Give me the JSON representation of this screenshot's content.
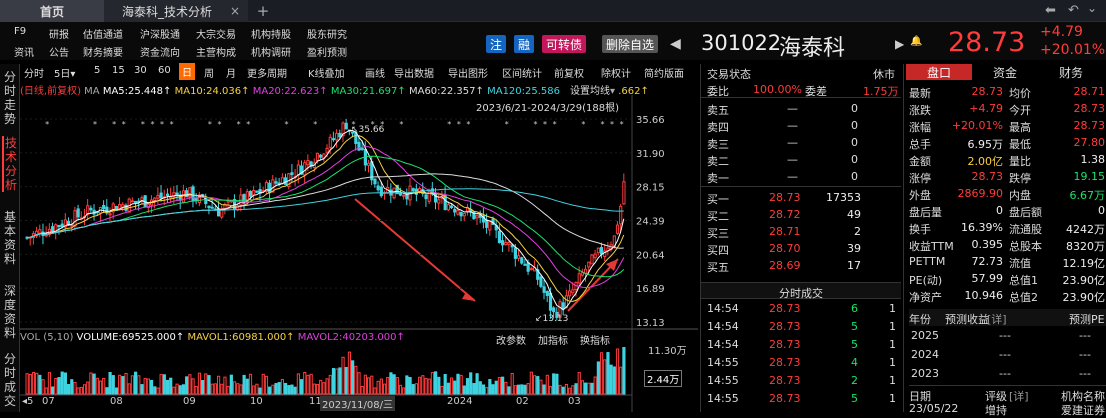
{
  "tabs": {
    "home": "首页",
    "active": "海泰科_技术分析",
    "close": "×",
    "add": "+"
  },
  "window_controls": {
    "back": "⬅",
    "undo": "↶",
    "more": "⌄"
  },
  "menu_row1": [
    "F9",
    "研报",
    "估值通道",
    "沪深股通",
    "大宗交易",
    "机构持股",
    "股东研究"
  ],
  "menu_row2": [
    "资讯",
    "公告",
    "财务摘要",
    "资金流向",
    "主营构成",
    "机构调研",
    "盈利预测"
  ],
  "badges": {
    "zhu": "注",
    "rong": "融",
    "convert": "可转债",
    "delete_fav": "删除自选"
  },
  "stock": {
    "code": "301022",
    "name": "海泰科",
    "price": "28.73",
    "change": "+4.79",
    "change_pct": "+20.01%",
    "prev_arrow": "◀",
    "next_arrow": "▶",
    "bell": "🔔"
  },
  "toolbar": {
    "items": [
      "分时",
      "5日",
      "5",
      "15",
      "30",
      "60",
      "日",
      "周",
      "月",
      "更多周期",
      "K线叠加",
      "画线",
      "导出数据",
      "导出图形",
      "区间统计",
      "前复权",
      "除权计",
      "简约版面"
    ],
    "dropdown_suffix": "▾"
  },
  "left_nav": [
    {
      "label": "分时走势",
      "active": false
    },
    {
      "label": "技术分析",
      "active": true
    },
    {
      "label": "基本资料",
      "active": false
    },
    {
      "label": "深度资料",
      "active": false
    },
    {
      "label": "分时成交",
      "active": false
    }
  ],
  "chart": {
    "legend_prefix": "(日线,前复权)",
    "ma_legend": [
      {
        "label": "MA",
        "color": "#aaaaaa"
      },
      {
        "label": "MA5:25.448↑",
        "color": "#ffffff"
      },
      {
        "label": "MA10:24.036↑",
        "color": "#f5d142"
      },
      {
        "label": "MA20:22.623↑",
        "color": "#e040e0"
      },
      {
        "label": "MA30:21.697↑",
        "color": "#19e36b"
      },
      {
        "label": "MA60:22.357↑",
        "color": "#dddddd"
      },
      {
        "label": "MA120:25.586",
        "color": "#3fd3e0"
      }
    ],
    "ma_tail": ".662↑",
    "setting_label": "设置均线",
    "date_range": "2023/6/21-2024/3/29(188根)",
    "price_ticks": [
      "35.66",
      "31.90",
      "28.15",
      "24.39",
      "20.64",
      "16.89",
      "13.13"
    ],
    "annot_high": "35.66",
    "annot_low": "13.13",
    "vol_legend": [
      {
        "label": "VOL (5,10)",
        "color": "#aaaaaa"
      },
      {
        "label": "VOLUME:69525.000↑",
        "color": "#ffffff"
      },
      {
        "label": "MAVOL1:60981.000↑",
        "color": "#f5d142"
      },
      {
        "label": "MAVOL2:40203.000↑",
        "color": "#e040e0"
      }
    ],
    "vol_tools": [
      "改参数",
      "加指标",
      "换指标"
    ],
    "vol_ticks": [
      "11.30万",
      "2.44万"
    ],
    "x_ticks": [
      "07",
      "08",
      "09",
      "10",
      "11",
      "2023/11/08/三",
      "2024",
      "02",
      "03"
    ],
    "x_left_marker": "◂5"
  },
  "chart_data": {
    "type": "candlestick",
    "title": "",
    "date_range": "2023/6/21-2024/3/29",
    "bars": 188,
    "ylim": [
      13.13,
      35.66
    ],
    "high": 35.66,
    "low": 13.13,
    "last_close": 28.73,
    "ma": {
      "MA5": 25.448,
      "MA10": 24.036,
      "MA20": 22.623,
      "MA30": 21.697,
      "MA60": 22.357,
      "MA120": 25.586
    },
    "volume": {
      "VOLUME": 69525,
      "MAVOL1": 60981,
      "MAVOL2": 40203
    },
    "volume_ticks": [
      "11.30万",
      "2.44万"
    ]
  },
  "orderbook": {
    "title": "交易状态",
    "status": "休市",
    "weibi_label": "委比",
    "weibi": "100.00%",
    "weicha_label": "委差",
    "weicha": "1.75万",
    "sells": [
      {
        "label": "卖五",
        "price": "—",
        "vol": "0"
      },
      {
        "label": "卖四",
        "price": "—",
        "vol": "0"
      },
      {
        "label": "卖三",
        "price": "—",
        "vol": "0"
      },
      {
        "label": "卖二",
        "price": "—",
        "vol": "0"
      },
      {
        "label": "卖一",
        "price": "—",
        "vol": "0"
      }
    ],
    "buys": [
      {
        "label": "买一",
        "price": "28.73",
        "vol": "17353"
      },
      {
        "label": "买二",
        "price": "28.72",
        "vol": "49"
      },
      {
        "label": "买三",
        "price": "28.71",
        "vol": "2"
      },
      {
        "label": "买四",
        "price": "28.70",
        "vol": "39"
      },
      {
        "label": "买五",
        "price": "28.69",
        "vol": "17"
      }
    ],
    "trades_title": "分时成交",
    "trades": [
      {
        "time": "14:54",
        "price": "28.73",
        "vol": "6",
        "n": "1"
      },
      {
        "time": "14:54",
        "price": "28.73",
        "vol": "5",
        "n": "1"
      },
      {
        "time": "14:54",
        "price": "28.73",
        "vol": "5",
        "n": "1"
      },
      {
        "time": "14:55",
        "price": "28.73",
        "vol": "4",
        "n": "1"
      },
      {
        "time": "14:55",
        "price": "28.73",
        "vol": "2",
        "n": "1"
      },
      {
        "time": "14:55",
        "price": "28.73",
        "vol": "5",
        "n": "1"
      }
    ]
  },
  "quote": {
    "tabs": [
      "盘口",
      "资金",
      "财务"
    ],
    "rows": [
      {
        "l1": "最新",
        "v1": "28.73",
        "c1": "red",
        "l2": "均价",
        "v2": "28.71",
        "c2": "red"
      },
      {
        "l1": "涨跌",
        "v1": "+4.79",
        "c1": "red",
        "l2": "今开",
        "v2": "28.73",
        "c2": "red"
      },
      {
        "l1": "涨幅",
        "v1": "+20.01%",
        "c1": "red",
        "l2": "最高",
        "v2": "28.73",
        "c2": "red"
      },
      {
        "l1": "总手",
        "v1": "6.95万",
        "c1": "white",
        "l2": "最低",
        "v2": "27.80",
        "c2": "red"
      },
      {
        "l1": "金额",
        "v1": "2.00亿",
        "c1": "yellow",
        "l2": "量比",
        "v2": "1.38",
        "c2": "white"
      },
      {
        "l1": "涨停",
        "v1": "28.73",
        "c1": "red",
        "l2": "跌停",
        "v2": "19.15",
        "c2": "green"
      },
      {
        "l1": "外盘",
        "v1": "2869.90",
        "c1": "red",
        "l2": "内盘",
        "v2": "6.67万",
        "c2": "green"
      },
      {
        "l1": "盘后量",
        "v1": "0",
        "c1": "white",
        "l2": "盘后额",
        "v2": "0",
        "c2": "white"
      },
      {
        "l1": "换手",
        "v1": "16.39%",
        "c1": "white",
        "l2": "流通股",
        "v2": "4242万",
        "c2": "white"
      },
      {
        "l1": "收益TTM",
        "v1": "0.395",
        "c1": "white",
        "l2": "总股本",
        "v2": "8320万",
        "c2": "white"
      },
      {
        "l1": "PETTM",
        "v1": "72.73",
        "c1": "white",
        "l2": "流值",
        "v2": "12.19亿",
        "c2": "white"
      },
      {
        "l1": "PE(动)",
        "v1": "57.99",
        "c1": "white",
        "l2": "总值1",
        "v2": "23.90亿",
        "c2": "white"
      },
      {
        "l1": "净资产",
        "v1": "10.946",
        "c1": "white",
        "l2": "总值2",
        "v2": "23.90亿",
        "c2": "white"
      }
    ],
    "forecast_head": {
      "year": "年份",
      "eps": "预测收益",
      "detail": "[详]",
      "pe": "预测PE"
    },
    "forecast": [
      {
        "year": "2025",
        "eps": "---",
        "pe": "---"
      },
      {
        "year": "2024",
        "eps": "---",
        "pe": "---"
      },
      {
        "year": "2023",
        "eps": "---",
        "pe": "---"
      }
    ],
    "rating_head": {
      "date": "日期",
      "rating": "评级",
      "detail": "[详]",
      "org": "机构名称"
    },
    "rating_row": {
      "date": "23/05/22",
      "rating": "增持",
      "org": "爱建证券"
    }
  }
}
